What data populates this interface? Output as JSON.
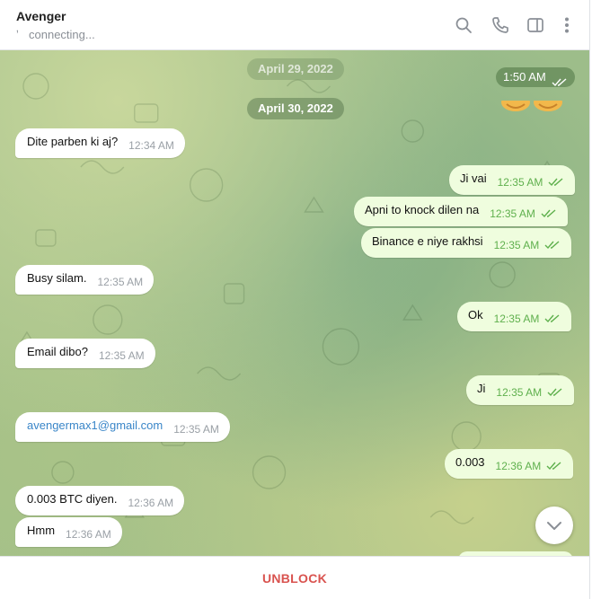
{
  "header": {
    "title": "Avenger",
    "status": "connecting...",
    "icons": [
      "search-icon",
      "phone-icon",
      "sidebar-toggle-icon",
      "more-vertical-icon"
    ]
  },
  "colors": {
    "incoming_bubble": "#ffffff",
    "outgoing_bubble": "#effdde",
    "read_ticks": "#5fb04d",
    "link": "#3a86c8",
    "unblock": "#d9534f"
  },
  "chat": {
    "sticker_time": "1:50 AM",
    "date_separators": [
      "April 29, 2022",
      "April 30, 2022"
    ],
    "messages": [
      {
        "direction": "in",
        "text": "Dite parben ki aj?",
        "time": "12:34 AM"
      },
      {
        "direction": "out",
        "text": "Ji vai",
        "time": "12:35 AM"
      },
      {
        "direction": "out",
        "text": "Apni to knock dilen na",
        "time": "12:35 AM"
      },
      {
        "direction": "out",
        "text": "Binance e niye rakhsi",
        "time": "12:35 AM"
      },
      {
        "direction": "in",
        "text": "Busy silam.",
        "time": "12:35 AM"
      },
      {
        "direction": "out",
        "text": "Ok",
        "time": "12:35 AM"
      },
      {
        "direction": "in",
        "text": "Email dibo?",
        "time": "12:35 AM"
      },
      {
        "direction": "out",
        "text": "Ji",
        "time": "12:35 AM"
      },
      {
        "direction": "in",
        "text": "avengermax1@gmail.com",
        "time": "12:35 AM",
        "is_link": true
      },
      {
        "direction": "out",
        "text": "0.003",
        "time": "12:36 AM"
      },
      {
        "direction": "in",
        "text": "0.003 BTC diyen.",
        "time": "12:36 AM"
      },
      {
        "direction": "in",
        "text": "Hmm",
        "time": "12:36 AM"
      }
    ]
  },
  "footer": {
    "unblock_label": "UNBLOCK"
  }
}
